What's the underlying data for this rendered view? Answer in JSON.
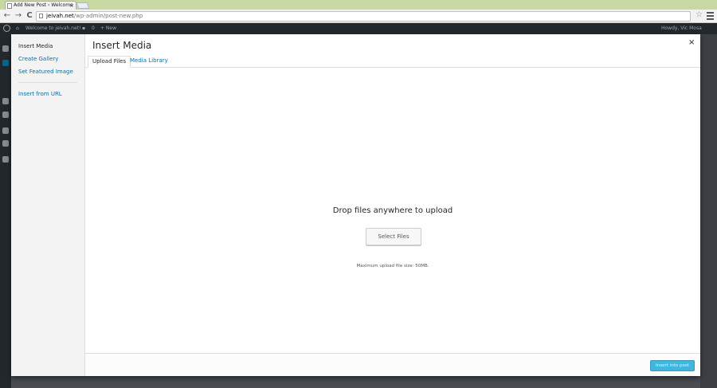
{
  "browser": {
    "tab_title": "Add New Post ‹ Welcome",
    "tab_close": "×",
    "url_host": "jeivah.net",
    "url_path": "/wp-admin/post-new.php",
    "back": "←",
    "forward": "→",
    "reload": "C",
    "star": "☆"
  },
  "adminbar": {
    "site_name": "Welcome to jeivah.net!",
    "comments_count": "0",
    "new_label": "+ New",
    "howdy": "Howdy, Vic Mosa"
  },
  "modal": {
    "menu": {
      "items": [
        {
          "label": "Insert Media"
        },
        {
          "label": "Create Gallery"
        },
        {
          "label": "Set Featured Image"
        },
        {
          "label": "Insert from URL"
        }
      ]
    },
    "title": "Insert Media",
    "close": "×",
    "tabs": [
      {
        "label": "Upload Files"
      },
      {
        "label": "Media Library"
      }
    ],
    "uploader": {
      "drop_title": "Drop files anywhere to upload",
      "select_button": "Select Files",
      "max_size": "Maximum upload file size: 50MB."
    },
    "insert_button": "Insert into post"
  }
}
